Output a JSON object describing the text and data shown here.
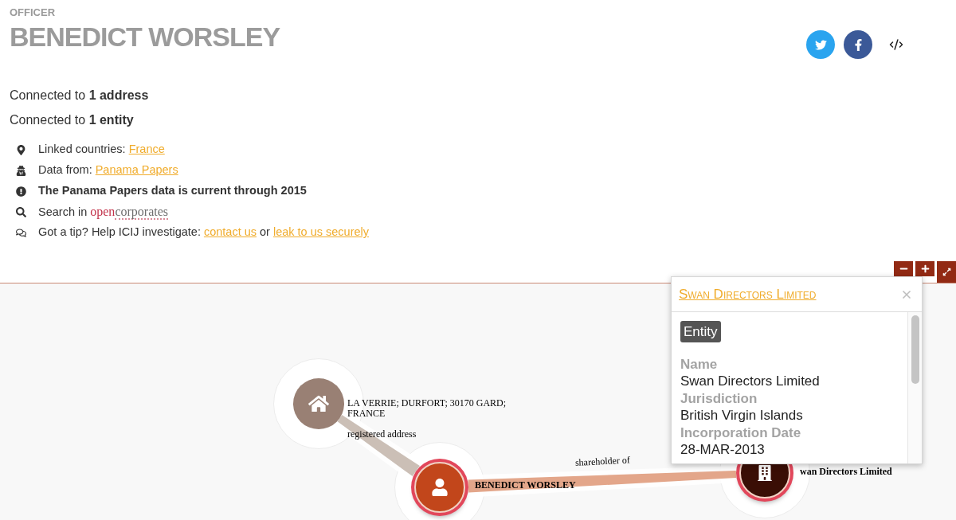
{
  "header": {
    "type_label": "OFFICER",
    "name": "BENEDICT WORSLEY"
  },
  "connections": [
    "Connected to **1 address**",
    "Connected to **1 entity**"
  ],
  "info": [
    {
      "kind": "location",
      "segments": [
        {
          "kind": "text",
          "text": "Linked countries:"
        },
        {
          "kind": "link",
          "text": "France"
        }
      ]
    },
    {
      "kind": "source",
      "segments": [
        {
          "kind": "text",
          "text": "Data from:"
        },
        {
          "kind": "link",
          "text": "Panama Papers"
        }
      ]
    },
    {
      "kind": "notice",
      "segments": [
        {
          "kind": "bold",
          "text": "The Panama Papers data is current through 2015"
        }
      ]
    },
    {
      "kind": "search",
      "segments": [
        {
          "kind": "text",
          "text": "Search in"
        },
        {
          "kind": "logo",
          "parts": [
            "open",
            "corporates"
          ]
        }
      ]
    },
    {
      "kind": "tip",
      "segments": [
        {
          "kind": "text",
          "text": "Got a tip? Help ICIJ investigate:"
        },
        {
          "kind": "link",
          "text": "contact us"
        },
        {
          "kind": "text",
          "text": "or"
        },
        {
          "kind": "link",
          "text": "leak to us securely"
        }
      ]
    }
  ],
  "graph": {
    "nodes": [
      {
        "kind": "address",
        "label": "LA VERRIE; DURFORT; 30170 GARD; FRANCE",
        "highlighted": false
      },
      {
        "kind": "officer",
        "label": "BENEDICT WORSLEY",
        "highlighted": true
      },
      {
        "kind": "entity",
        "label": "wan Directors Limited",
        "highlighted": true
      }
    ],
    "edges": [
      {
        "label": "registered address"
      },
      {
        "label": "shareholder of"
      }
    ]
  },
  "popup": {
    "title": "Swan Directors Limited",
    "badge": "Entity",
    "fields": [
      {
        "label": "Name",
        "value": "Swan Directors Limited"
      },
      {
        "label": "Jurisdiction",
        "value": "British Virgin Islands"
      },
      {
        "label": "Incorporation Date",
        "value": "28-MAR-2013"
      }
    ]
  }
}
